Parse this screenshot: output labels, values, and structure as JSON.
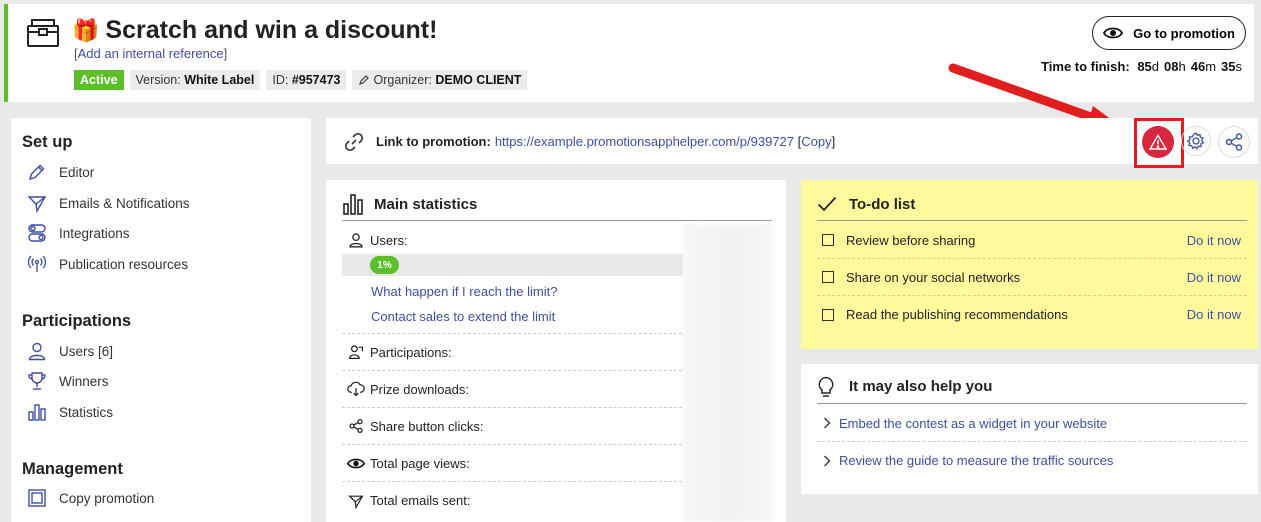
{
  "header": {
    "title": "Scratch and win a discount!",
    "gift_emoji": "🎁",
    "internal_reference": "Add an internal reference",
    "status": "Active",
    "version_label": "Version:",
    "version_value": "White Label",
    "id_label": "ID:",
    "id_value": "#957473",
    "organizer_label": "Organizer:",
    "organizer_value": "DEMO CLIENT",
    "go_button": "Go to promotion",
    "time_label": "Time to finish:",
    "time": {
      "days": "85",
      "days_unit": "d",
      "hours": "08",
      "hours_unit": "h",
      "minutes": "46",
      "minutes_unit": "m",
      "seconds": "35",
      "seconds_unit": "s"
    }
  },
  "sidebar": {
    "setup_title": "Set up",
    "setup_items": [
      "Editor",
      "Emails & Notifications",
      "Integrations",
      "Publication resources"
    ],
    "participations_title": "Participations",
    "participations_items": [
      "Users [6]",
      "Winners",
      "Statistics"
    ],
    "management_title": "Management",
    "management_items": [
      "Copy promotion"
    ]
  },
  "link_bar": {
    "label": "Link to promotion:",
    "url": "https://example.promotionsapphelper.com/p/939727",
    "copy": "Copy"
  },
  "stats": {
    "title": "Main statistics",
    "users_label": "Users:",
    "progress_percent": 1,
    "progress_label": "1%",
    "link_limit": "What happen if I reach the limit?",
    "link_sales": "Contact sales to extend the limit",
    "rows": [
      "Participations:",
      "Prize downloads:",
      "Share button clicks:",
      "Total page views:",
      "Total emails sent:"
    ]
  },
  "todo": {
    "title": "To-do list",
    "items": [
      {
        "label": "Review before sharing",
        "action": "Do it now"
      },
      {
        "label": "Share on your social networks",
        "action": "Do it now"
      },
      {
        "label": "Read the publishing recommendations",
        "action": "Do it now"
      }
    ]
  },
  "help": {
    "title": "It may also help you",
    "links": [
      "Embed the contest as a widget in your website",
      "Review the guide to measure the traffic sources"
    ]
  },
  "colors": {
    "active_green": "#5cbf2a",
    "link_blue": "#3d4fa1",
    "alert_red": "#d7263d",
    "todo_yellow": "#fffb9c",
    "highlight_red": "#e21d1d"
  },
  "icons": {
    "logo": "treasure-chest-icon",
    "alert": "warning-triangle-icon",
    "settings": "gear-icon",
    "share": "share-icon"
  }
}
